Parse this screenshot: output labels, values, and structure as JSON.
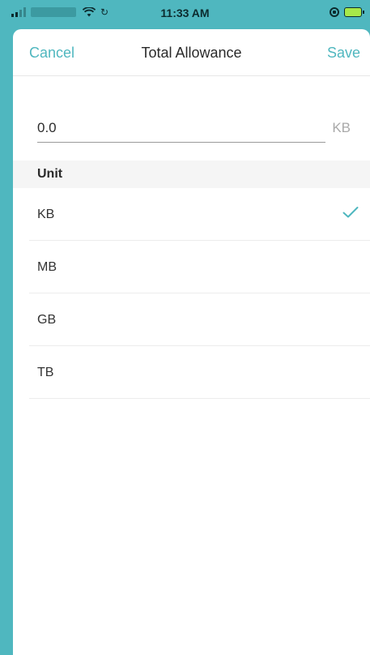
{
  "status_bar": {
    "time": "11:33 AM",
    "icons": [
      "signal-icon",
      "wifi-icon",
      "activity-icon",
      "rotation-lock-icon",
      "battery-charging-icon"
    ]
  },
  "nav": {
    "cancel_label": "Cancel",
    "title": "Total Allowance",
    "save_label": "Save"
  },
  "allowance": {
    "value": "0.0",
    "unit_suffix": "KB"
  },
  "unit_section": {
    "header": "Unit",
    "options": [
      {
        "label": "KB",
        "selected": true
      },
      {
        "label": "MB",
        "selected": false
      },
      {
        "label": "GB",
        "selected": false
      },
      {
        "label": "TB",
        "selected": false
      }
    ]
  },
  "colors": {
    "accent": "#4fb7bf",
    "section_bg": "#f5f5f5",
    "text": "#333333",
    "muted": "#a9a9a9"
  }
}
